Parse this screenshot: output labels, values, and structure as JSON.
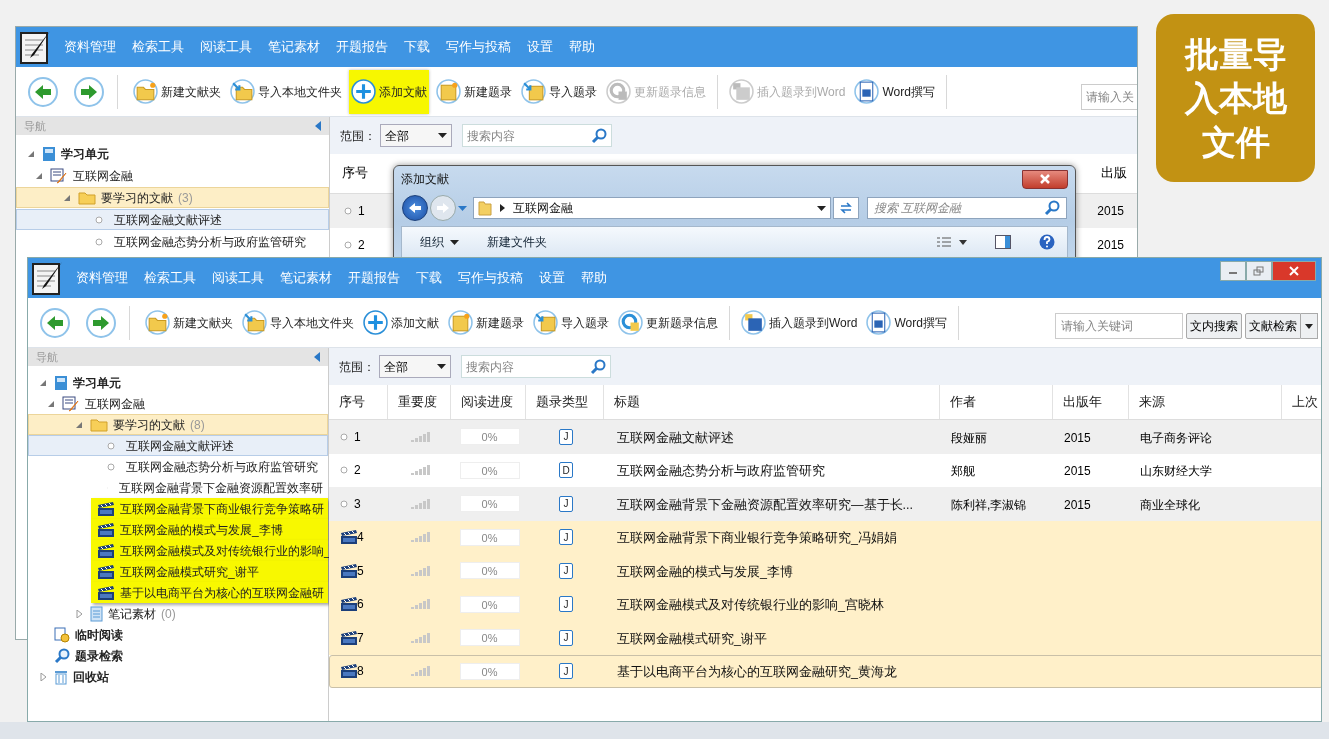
{
  "badge": {
    "text": "批量导入本地文件"
  },
  "back_window": {
    "menu": [
      "资料管理",
      "检索工具",
      "阅读工具",
      "笔记素材",
      "开题报告",
      "下载",
      "写作与投稿",
      "设置",
      "帮助"
    ],
    "toolbar": [
      {
        "kind": "folder-new",
        "label": "新建文献夹",
        "highlighted": false,
        "disabled": false
      },
      {
        "kind": "folder-import",
        "label": "导入本地文件夹",
        "highlighted": false,
        "disabled": false
      },
      {
        "kind": "add",
        "label": "添加文献",
        "highlighted": true,
        "disabled": false
      },
      {
        "kind": "record-new",
        "label": "新建题录",
        "highlighted": false,
        "disabled": false
      },
      {
        "kind": "record-import",
        "label": "导入题录",
        "highlighted": false,
        "disabled": false
      },
      {
        "kind": "refresh",
        "label": "更新题录信息",
        "highlighted": false,
        "disabled": true
      },
      {
        "kind": "word-insert",
        "label": "插入题录到Word",
        "highlighted": false,
        "disabled": true
      },
      {
        "kind": "word-write",
        "label": "Word撰写",
        "highlighted": false,
        "disabled": false
      }
    ],
    "keyword_field": {
      "placeholder": "请输入关"
    },
    "nav_title": "导航",
    "tree": [
      {
        "kind": "book",
        "label": "学习单元",
        "bold": true,
        "expanded": true,
        "children": [
          {
            "kind": "cel",
            "label": "互联网金融",
            "expanded": true,
            "children": [
              {
                "kind": "folder",
                "label": "要学习的文献",
                "count": "(3)",
                "expanded": true,
                "highlighted": true,
                "children": [
                  {
                    "kind": "doc",
                    "label": "互联网金融文献评述",
                    "selected": true
                  },
                  {
                    "kind": "doc",
                    "label": "互联网金融态势分析与政府监管研究",
                    "selected": false
                  }
                ]
              }
            ]
          }
        ]
      }
    ],
    "scope_label": "范围：",
    "scope_value": "全部",
    "search": {
      "placeholder": "搜索内容"
    },
    "columns": [
      "序号",
      "出版"
    ],
    "rows": [
      {
        "no": "1",
        "year": "2015"
      },
      {
        "no": "2",
        "year": "2015"
      }
    ]
  },
  "dialog": {
    "title": "添加文献",
    "path": "互联网金融",
    "search": {
      "placeholder": "搜索 互联网金融"
    },
    "organize": "组织",
    "new_folder": "新建文件夹"
  },
  "front_window": {
    "menu": [
      "资料管理",
      "检索工具",
      "阅读工具",
      "笔记素材",
      "开题报告",
      "下载",
      "写作与投稿",
      "设置",
      "帮助"
    ],
    "toolbar": [
      {
        "kind": "folder-new",
        "label": "新建文献夹",
        "highlighted": false,
        "disabled": false
      },
      {
        "kind": "folder-import",
        "label": "导入本地文件夹",
        "highlighted": false,
        "disabled": false
      },
      {
        "kind": "add",
        "label": "添加文献",
        "highlighted": false,
        "disabled": false
      },
      {
        "kind": "record-new",
        "label": "新建题录",
        "highlighted": false,
        "disabled": false
      },
      {
        "kind": "record-import",
        "label": "导入题录",
        "highlighted": false,
        "disabled": false
      },
      {
        "kind": "refresh",
        "label": "更新题录信息",
        "highlighted": false,
        "disabled": false
      },
      {
        "kind": "word-insert",
        "label": "插入题录到Word",
        "highlighted": false,
        "disabled": false
      },
      {
        "kind": "word-write",
        "label": "Word撰写",
        "highlighted": false,
        "disabled": false
      }
    ],
    "keyword_field": {
      "placeholder": "请输入关键词"
    },
    "search_buttons": [
      "文内搜索",
      "文献检索"
    ],
    "nav_title": "导航",
    "tree": [
      {
        "kind": "book",
        "label": "学习单元",
        "bold": true,
        "expanded": true,
        "children": [
          {
            "kind": "cel",
            "label": "互联网金融",
            "expanded": true,
            "children": [
              {
                "kind": "folder",
                "label": "要学习的文献",
                "count": "(8)",
                "expanded": true,
                "highlighted": true,
                "children": [
                  {
                    "kind": "doc",
                    "label": "互联网金融文献评述",
                    "selected": true
                  },
                  {
                    "kind": "doc",
                    "label": "互联网金融态势分析与政府监管研究",
                    "selected": false
                  },
                  {
                    "kind": "doc",
                    "label": "互联网金融背景下金融资源配置效率研",
                    "selected": false
                  },
                  {
                    "kind": "caj",
                    "label": "互联网金融背景下商业银行竞争策略研",
                    "selected": false,
                    "highlighted": true
                  },
                  {
                    "kind": "caj",
                    "label": "互联网金融的模式与发展_李博",
                    "selected": false,
                    "highlighted": true
                  },
                  {
                    "kind": "caj",
                    "label": "互联网金融模式及对传统银行业的影响_",
                    "selected": false,
                    "highlighted": true
                  },
                  {
                    "kind": "caj",
                    "label": "互联网金融模式研究_谢平",
                    "selected": false,
                    "highlighted": true
                  },
                  {
                    "kind": "caj",
                    "label": "基于以电商平台为核心的互联网金融研",
                    "selected": false,
                    "highlighted": true
                  }
                ]
              },
              {
                "kind": "notes",
                "label": "笔记素材",
                "count": "(0)",
                "expanded": false
              }
            ]
          }
        ]
      },
      {
        "kind": "clock",
        "label": "临时阅读",
        "bold": true
      },
      {
        "kind": "search",
        "label": "题录检索",
        "bold": true
      },
      {
        "kind": "trash",
        "label": "回收站",
        "bold": true,
        "expanded": false
      }
    ],
    "scope_label": "范围：",
    "scope_value": "全部",
    "search": {
      "placeholder": "搜索内容"
    },
    "columns": [
      "序号",
      "重要度",
      "阅读进度",
      "题录类型",
      "标题",
      "作者",
      "出版年",
      "来源",
      "上次"
    ],
    "rows": [
      {
        "kind": "plain",
        "no": "1",
        "progress": "0%",
        "type": "J",
        "title": "互联网金融文献评述",
        "author": "段娅丽",
        "year": "2015",
        "source": "电子商务评论",
        "selected": true,
        "focused": false
      },
      {
        "kind": "plain",
        "no": "2",
        "progress": "0%",
        "type": "D",
        "title": "互联网金融态势分析与政府监管研究",
        "author": "郑舰",
        "year": "2015",
        "source": "山东财经大学",
        "selected": false,
        "focused": false
      },
      {
        "kind": "plain",
        "no": "3",
        "progress": "0%",
        "type": "J",
        "title": "互联网金融背景下金融资源配置效率研究—基于长...",
        "author": "陈利祥,李淑锦",
        "year": "2015",
        "source": "商业全球化",
        "selected": true,
        "focused": false
      },
      {
        "kind": "caj",
        "no": "4",
        "progress": "0%",
        "type": "J",
        "title": "互联网金融背景下商业银行竞争策略研究_冯娟娟",
        "selected": false,
        "focused": false
      },
      {
        "kind": "caj",
        "no": "5",
        "progress": "0%",
        "type": "J",
        "title": "互联网金融的模式与发展_李博",
        "selected": false,
        "focused": false
      },
      {
        "kind": "caj",
        "no": "6",
        "progress": "0%",
        "type": "J",
        "title": "互联网金融模式及对传统银行业的影响_宫晓林",
        "selected": false,
        "focused": false
      },
      {
        "kind": "caj",
        "no": "7",
        "progress": "0%",
        "type": "J",
        "title": "互联网金融模式研究_谢平",
        "selected": false,
        "focused": false
      },
      {
        "kind": "caj",
        "no": "8",
        "progress": "0%",
        "type": "J",
        "title": "基于以电商平台为核心的互联网金融研究_黄海龙",
        "selected": false,
        "focused": true
      }
    ]
  }
}
